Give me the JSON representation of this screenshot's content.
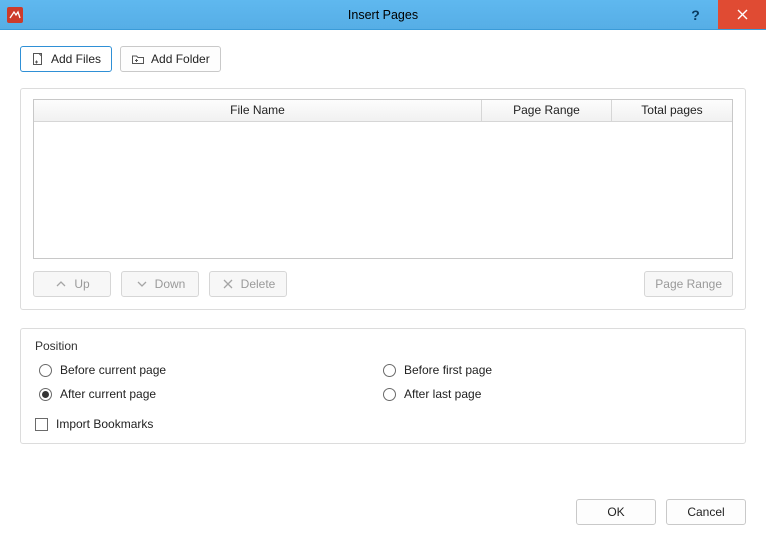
{
  "window": {
    "title": "Insert Pages"
  },
  "toolbar": {
    "add_files_label": "Add Files",
    "add_folder_label": "Add Folder"
  },
  "table": {
    "headers": {
      "file_name": "File Name",
      "page_range": "Page Range",
      "total_pages": "Total pages"
    },
    "rows": [],
    "actions": {
      "up": "Up",
      "down": "Down",
      "delete": "Delete",
      "page_range": "Page Range"
    }
  },
  "position": {
    "group_label": "Position",
    "options": {
      "before_current": "Before current page",
      "before_first": "Before first page",
      "after_current": "After current page",
      "after_last": "After last page"
    },
    "selected": "after_current"
  },
  "checkbox": {
    "import_bookmarks_label": "Import Bookmarks",
    "import_bookmarks_checked": false
  },
  "footer": {
    "ok": "OK",
    "cancel": "Cancel"
  }
}
